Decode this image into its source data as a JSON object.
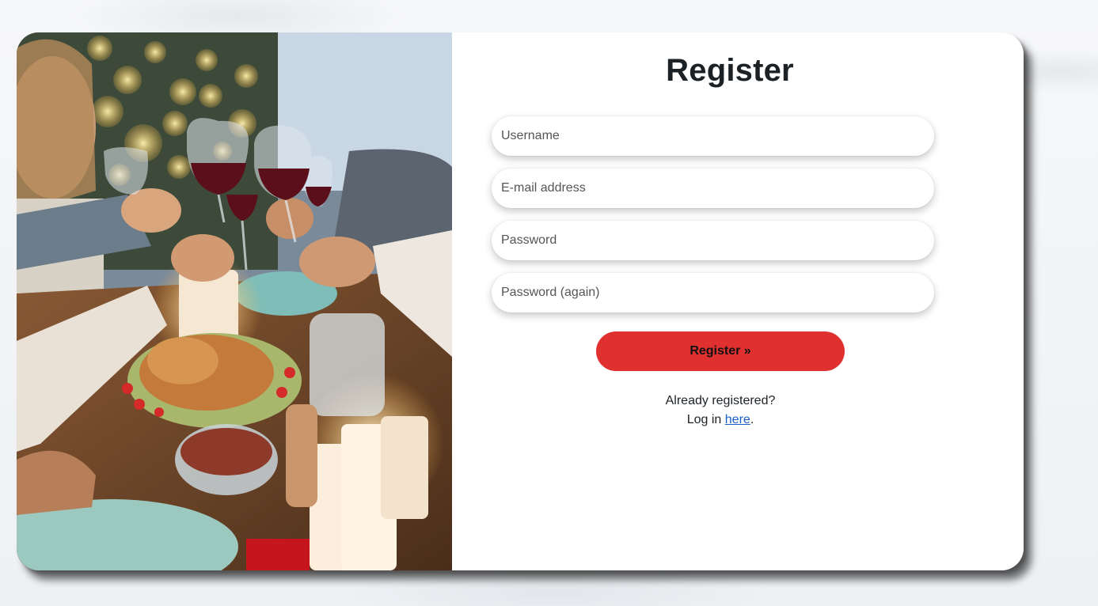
{
  "form": {
    "title": "Register",
    "username_placeholder": "Username",
    "email_placeholder": "E-mail address",
    "password_placeholder": "Password",
    "password_again_placeholder": "Password (again)",
    "submit_label": "Register »"
  },
  "footer": {
    "already_text": "Already registered?",
    "login_prefix": "Log in ",
    "login_link": "here",
    "login_suffix": "."
  },
  "colors": {
    "accent": "#e03030",
    "link": "#1a5fc9",
    "title": "#1c2126"
  },
  "image": {
    "semantic": "holiday-dinner-toast-photo"
  }
}
